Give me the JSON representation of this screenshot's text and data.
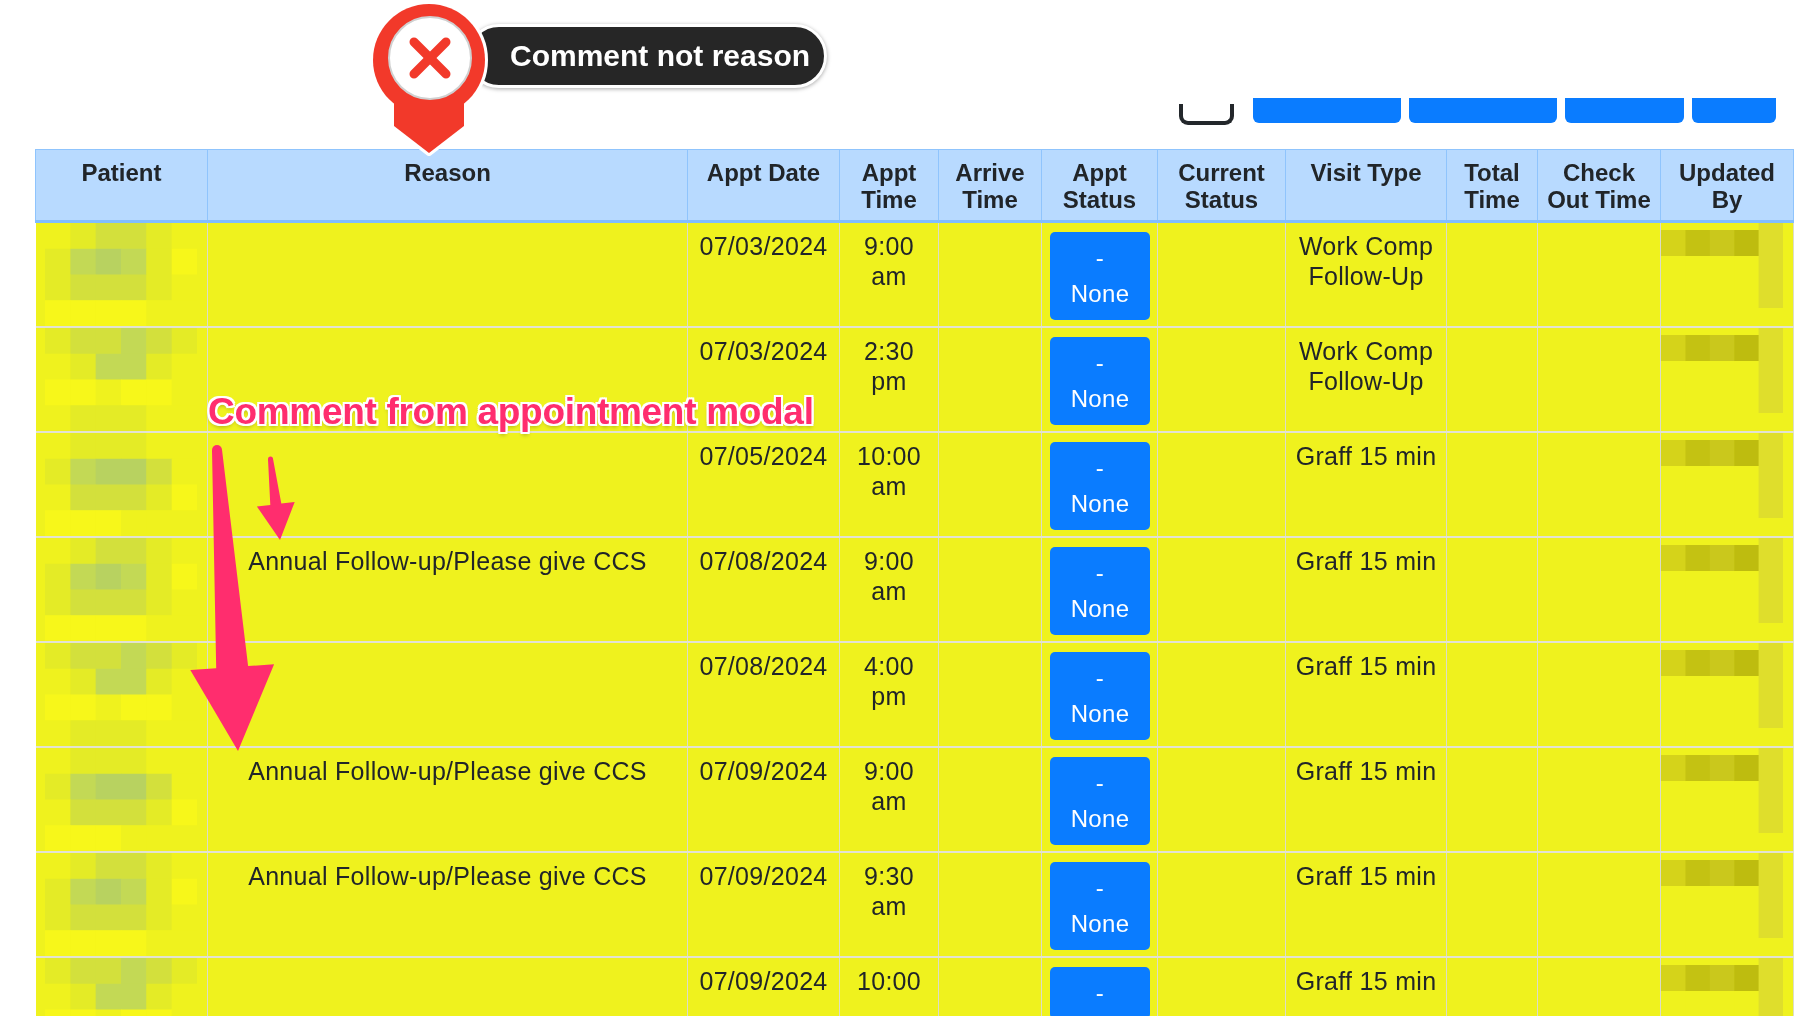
{
  "callout": {
    "text": "Comment not reason"
  },
  "toolbar": [
    {
      "kind": "outline"
    },
    {
      "kind": "button"
    },
    {
      "kind": "button"
    },
    {
      "kind": "button"
    },
    {
      "kind": "button"
    }
  ],
  "table": {
    "columns": [
      "Patient",
      "Reason",
      "Appt Date",
      "Appt Time",
      "Arrive Time",
      "Appt Status",
      "Current Status",
      "Visit Type",
      "Total Time",
      "Check Out Time",
      "Updated By"
    ],
    "rows": [
      {
        "patient": {
          "blurred": true
        },
        "appt_date": "07/03/2024",
        "appt_time": "9:00 am",
        "appt_status": "- None",
        "visit_type": "Work Comp Follow-Up",
        "updated_by": {
          "blurred": true
        }
      },
      {
        "patient": {
          "blurred": true
        },
        "appt_date": "07/03/2024",
        "appt_time": "2:30 pm",
        "appt_status": "- None",
        "visit_type": "Work Comp Follow-Up",
        "updated_by": {
          "blurred": true
        }
      },
      {
        "patient": {
          "blurred": true
        },
        "appt_date": "07/05/2024",
        "appt_time": "10:00 am",
        "appt_status": "- None",
        "visit_type": "Graff 15 min",
        "updated_by": {
          "blurred": true
        }
      },
      {
        "patient": {
          "blurred": true
        },
        "reason": "Annual Follow-up/Please give CCS",
        "appt_date": "07/08/2024",
        "appt_time": "9:00 am",
        "appt_status": "- None",
        "visit_type": "Graff 15 min",
        "updated_by": {
          "blurred": true
        }
      },
      {
        "patient": {
          "blurred": true
        },
        "appt_date": "07/08/2024",
        "appt_time": "4:00 pm",
        "appt_status": "- None",
        "visit_type": "Graff 15 min",
        "updated_by": {
          "blurred": true
        }
      },
      {
        "patient": {
          "blurred": true
        },
        "reason": "Annual Follow-up/Please give CCS",
        "appt_date": "07/09/2024",
        "appt_time": "9:00 am",
        "appt_status": "- None",
        "visit_type": "Graff 15 min",
        "updated_by": {
          "blurred": true
        }
      },
      {
        "patient": {
          "blurred": true
        },
        "reason": "Annual Follow-up/Please give CCS",
        "appt_date": "07/09/2024",
        "appt_time": "9:30 am",
        "appt_status": "- None",
        "visit_type": "Graff 15 min",
        "updated_by": {
          "blurred": true
        }
      },
      {
        "patient": {
          "blurred": true
        },
        "appt_date": "07/09/2024",
        "appt_time": "10:00",
        "appt_status": "-",
        "visit_type": "Graff 15 min",
        "updated_by": {
          "blurred": true
        }
      }
    ]
  },
  "annotation": {
    "text": "Comment from appointment modal",
    "arrows": [
      {
        "kind": "long"
      },
      {
        "kind": "short"
      }
    ]
  }
}
